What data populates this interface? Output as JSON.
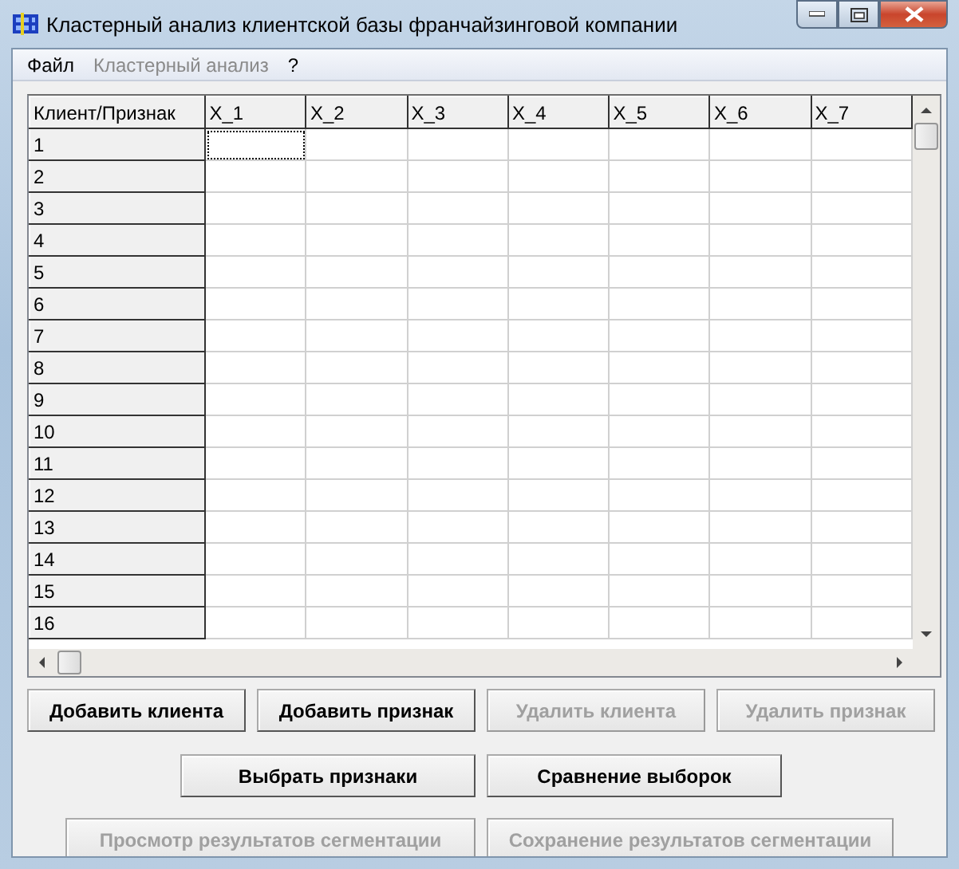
{
  "window": {
    "title": "Кластерный анализ клиентской базы франчайзинговой компании"
  },
  "menu": [
    {
      "label": "Файл",
      "disabled": false
    },
    {
      "label": "Кластерный анализ",
      "disabled": true
    },
    {
      "label": "?",
      "disabled": false
    }
  ],
  "grid": {
    "corner": "Клиент/Признак",
    "columns": [
      "X_1",
      "X_2",
      "X_3",
      "X_4",
      "X_5",
      "X_6",
      "X_7"
    ],
    "rows": [
      {
        "label": "1",
        "cells": [
          {
            "focused": true
          },
          {
            "focused": false
          },
          {
            "focused": false
          },
          {
            "focused": false
          },
          {
            "focused": false
          },
          {
            "focused": false
          },
          {
            "focused": false
          }
        ]
      },
      {
        "label": "2",
        "cells": [
          {
            "focused": false
          },
          {
            "focused": false
          },
          {
            "focused": false
          },
          {
            "focused": false
          },
          {
            "focused": false
          },
          {
            "focused": false
          },
          {
            "focused": false
          }
        ]
      },
      {
        "label": "3",
        "cells": [
          {
            "focused": false
          },
          {
            "focused": false
          },
          {
            "focused": false
          },
          {
            "focused": false
          },
          {
            "focused": false
          },
          {
            "focused": false
          },
          {
            "focused": false
          }
        ]
      },
      {
        "label": "4",
        "cells": [
          {
            "focused": false
          },
          {
            "focused": false
          },
          {
            "focused": false
          },
          {
            "focused": false
          },
          {
            "focused": false
          },
          {
            "focused": false
          },
          {
            "focused": false
          }
        ]
      },
      {
        "label": "5",
        "cells": [
          {
            "focused": false
          },
          {
            "focused": false
          },
          {
            "focused": false
          },
          {
            "focused": false
          },
          {
            "focused": false
          },
          {
            "focused": false
          },
          {
            "focused": false
          }
        ]
      },
      {
        "label": "6",
        "cells": [
          {
            "focused": false
          },
          {
            "focused": false
          },
          {
            "focused": false
          },
          {
            "focused": false
          },
          {
            "focused": false
          },
          {
            "focused": false
          },
          {
            "focused": false
          }
        ]
      },
      {
        "label": "7",
        "cells": [
          {
            "focused": false
          },
          {
            "focused": false
          },
          {
            "focused": false
          },
          {
            "focused": false
          },
          {
            "focused": false
          },
          {
            "focused": false
          },
          {
            "focused": false
          }
        ]
      },
      {
        "label": "8",
        "cells": [
          {
            "focused": false
          },
          {
            "focused": false
          },
          {
            "focused": false
          },
          {
            "focused": false
          },
          {
            "focused": false
          },
          {
            "focused": false
          },
          {
            "focused": false
          }
        ]
      },
      {
        "label": "9",
        "cells": [
          {
            "focused": false
          },
          {
            "focused": false
          },
          {
            "focused": false
          },
          {
            "focused": false
          },
          {
            "focused": false
          },
          {
            "focused": false
          },
          {
            "focused": false
          }
        ]
      },
      {
        "label": "10",
        "cells": [
          {
            "focused": false
          },
          {
            "focused": false
          },
          {
            "focused": false
          },
          {
            "focused": false
          },
          {
            "focused": false
          },
          {
            "focused": false
          },
          {
            "focused": false
          }
        ]
      },
      {
        "label": "11",
        "cells": [
          {
            "focused": false
          },
          {
            "focused": false
          },
          {
            "focused": false
          },
          {
            "focused": false
          },
          {
            "focused": false
          },
          {
            "focused": false
          },
          {
            "focused": false
          }
        ]
      },
      {
        "label": "12",
        "cells": [
          {
            "focused": false
          },
          {
            "focused": false
          },
          {
            "focused": false
          },
          {
            "focused": false
          },
          {
            "focused": false
          },
          {
            "focused": false
          },
          {
            "focused": false
          }
        ]
      },
      {
        "label": "13",
        "cells": [
          {
            "focused": false
          },
          {
            "focused": false
          },
          {
            "focused": false
          },
          {
            "focused": false
          },
          {
            "focused": false
          },
          {
            "focused": false
          },
          {
            "focused": false
          }
        ]
      },
      {
        "label": "14",
        "cells": [
          {
            "focused": false
          },
          {
            "focused": false
          },
          {
            "focused": false
          },
          {
            "focused": false
          },
          {
            "focused": false
          },
          {
            "focused": false
          },
          {
            "focused": false
          }
        ]
      },
      {
        "label": "15",
        "cells": [
          {
            "focused": false
          },
          {
            "focused": false
          },
          {
            "focused": false
          },
          {
            "focused": false
          },
          {
            "focused": false
          },
          {
            "focused": false
          },
          {
            "focused": false
          }
        ]
      },
      {
        "label": "16",
        "cells": [
          {
            "focused": false
          },
          {
            "focused": false
          },
          {
            "focused": false
          },
          {
            "focused": false
          },
          {
            "focused": false
          },
          {
            "focused": false
          },
          {
            "focused": false
          }
        ]
      }
    ]
  },
  "button_rows": [
    [
      {
        "label": "Добавить клиента",
        "disabled": false
      },
      {
        "label": "Добавить признак",
        "disabled": false
      },
      {
        "label": "Удалить клиента",
        "disabled": true
      },
      {
        "label": "Удалить признак",
        "disabled": true
      }
    ],
    [
      {
        "label": "Выбрать признаки",
        "disabled": false
      },
      {
        "label": "Сравнение выборок",
        "disabled": false
      }
    ],
    [
      {
        "label": "Просмотр результатов сегментации",
        "disabled": true
      },
      {
        "label": "Сохранение результатов сегментации",
        "disabled": true
      }
    ]
  ]
}
